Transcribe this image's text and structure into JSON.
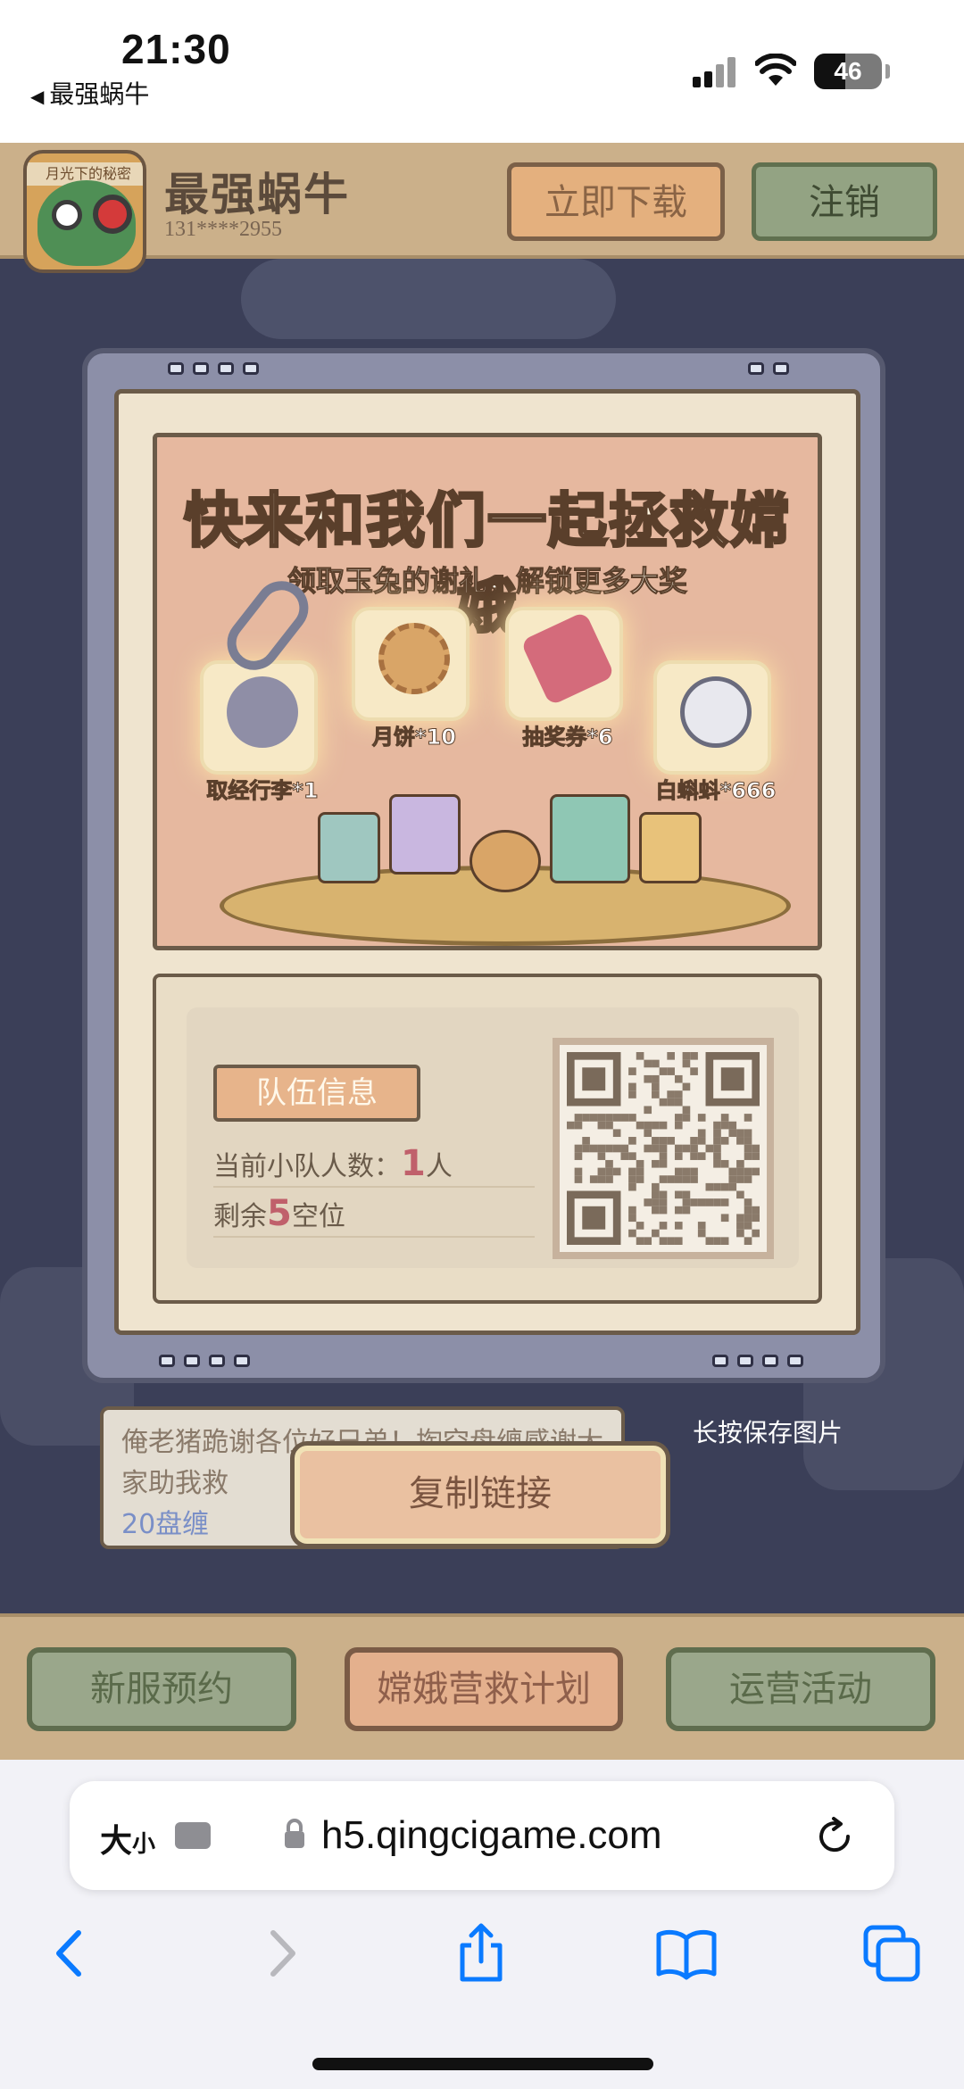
{
  "status_bar": {
    "time": "21:30",
    "back_label": "最强蜗牛",
    "battery": "46",
    "battery_level": 0.46
  },
  "header": {
    "avatar_badge": "月光下的秘密",
    "user_name": "最强蜗牛",
    "user_phone": "131****2955",
    "download_label": "立即下载",
    "logout_label": "注销"
  },
  "banner": {
    "title": "快来和我们一起拯救嫦娥",
    "subtitle": "领取玉兔的谢礼，解锁更多大奖",
    "rewards": [
      {
        "label": "取经行李*1",
        "icon": "luggage-bag-icon"
      },
      {
        "label": "月饼*10",
        "icon": "mooncake-icon"
      },
      {
        "label": "抽奖券*6",
        "icon": "lottery-ticket-icon"
      },
      {
        "label": "白蝌蚪*666",
        "icon": "white-tadpole-icon"
      }
    ]
  },
  "team": {
    "tag": "队伍信息",
    "count_prefix": "当前小队人数：",
    "count_value": "1",
    "count_suffix": "人",
    "seats_prefix": "剩余",
    "seats_value": "5",
    "seats_suffix": "空位"
  },
  "message": {
    "text": "俺老猪跪谢各位好兄弟！掏空盘缠感谢大家助我救",
    "link": "20盘缠"
  },
  "save_hint": "长按保存图片",
  "copy_button": "复制链接",
  "bottom_nav": {
    "new_server": "新服预约",
    "rescue_plan": "嫦娥营救计划",
    "operations": "运营活动"
  },
  "browser": {
    "text_size_label": "大",
    "text_size_small": "小",
    "url": "h5.qingcigame.com",
    "toolbar_icons": [
      "back-icon",
      "forward-icon",
      "share-icon",
      "bookmarks-icon",
      "tabs-icon"
    ]
  },
  "colors": {
    "page_bg": "#3b3f58",
    "paper": "#efe4cf",
    "accent": "#e4b08d",
    "green_button": "#9aa78b",
    "browser_blue": "#0a7aff"
  }
}
